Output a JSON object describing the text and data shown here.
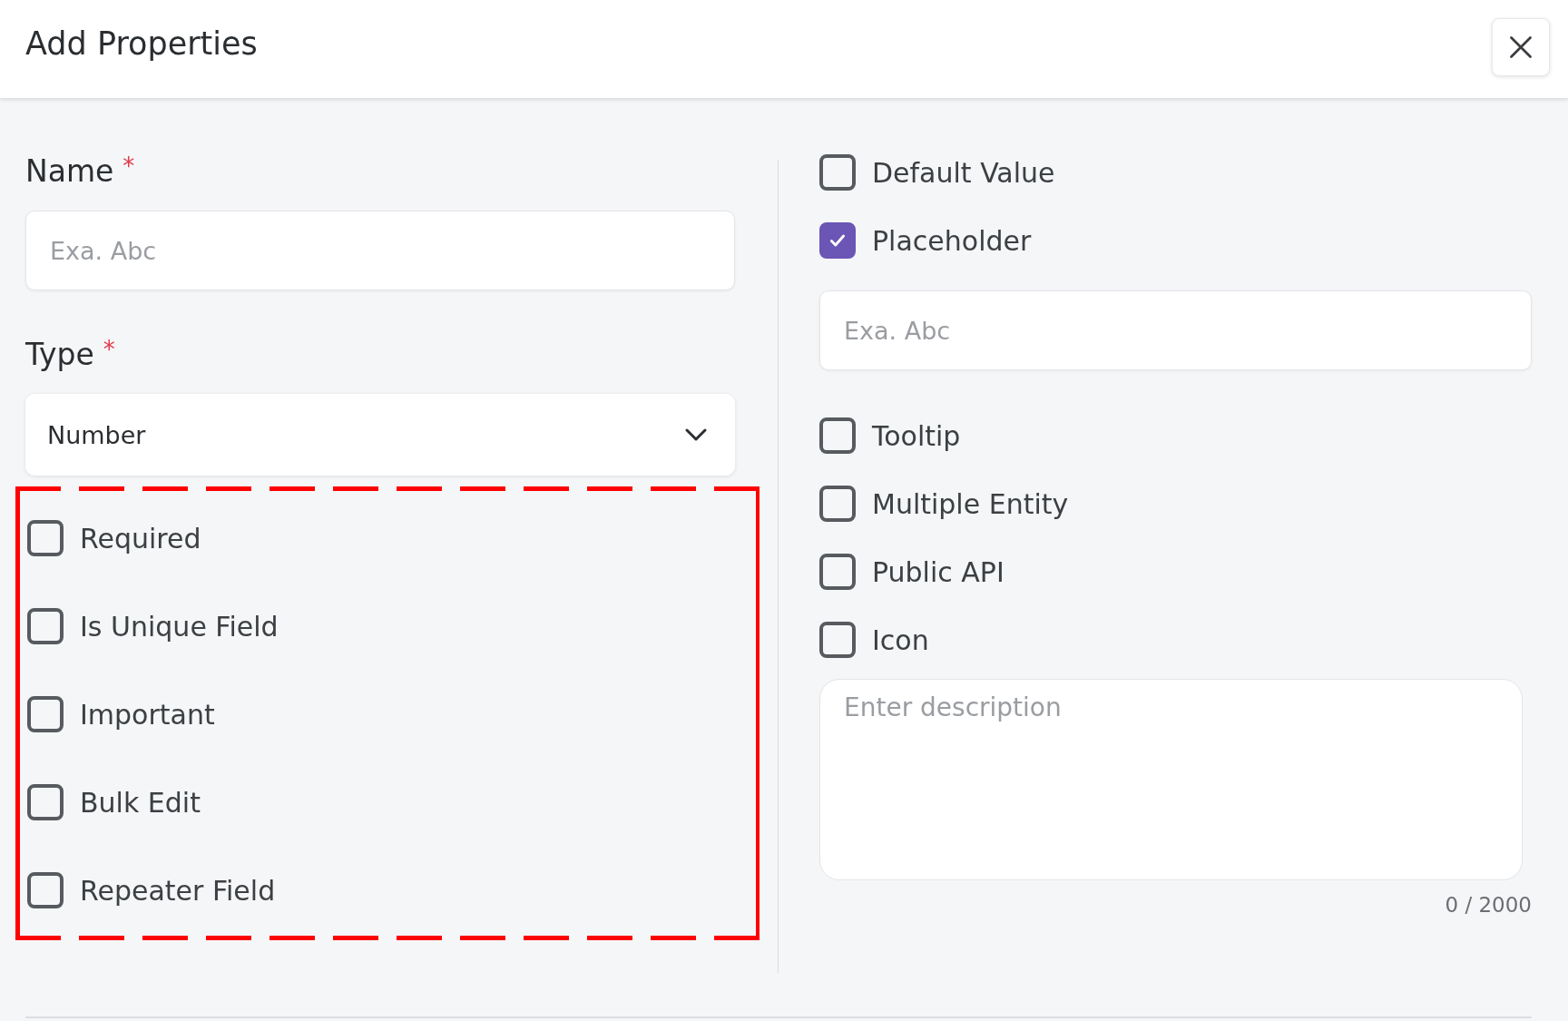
{
  "header": {
    "title": "Add Properties"
  },
  "left": {
    "name_field": {
      "label": "Name",
      "required_mark": "*",
      "placeholder": "Exa. Abc"
    },
    "type_field": {
      "label": "Type",
      "required_mark": "*",
      "value": "Number"
    },
    "options": [
      {
        "label": "Required",
        "checked": false
      },
      {
        "label": "Is Unique Field",
        "checked": false
      },
      {
        "label": "Important",
        "checked": false
      },
      {
        "label": "Bulk Edit",
        "checked": false
      },
      {
        "label": "Repeater Field",
        "checked": false
      }
    ]
  },
  "right": {
    "options": [
      {
        "kind": "checkbox",
        "label": "Default Value",
        "checked": false
      },
      {
        "kind": "checkbox",
        "label": "Placeholder",
        "checked": true
      },
      {
        "kind": "input",
        "placeholder": "Exa. Abc"
      },
      {
        "kind": "checkbox",
        "label": "Tooltip",
        "checked": false
      },
      {
        "kind": "checkbox",
        "label": "Multiple Entity",
        "checked": false
      },
      {
        "kind": "checkbox",
        "label": "Public API",
        "checked": false
      },
      {
        "kind": "checkbox",
        "label": "Icon",
        "checked": false
      }
    ],
    "description": {
      "placeholder": "Enter description",
      "counter": "0 / 2000"
    }
  }
}
